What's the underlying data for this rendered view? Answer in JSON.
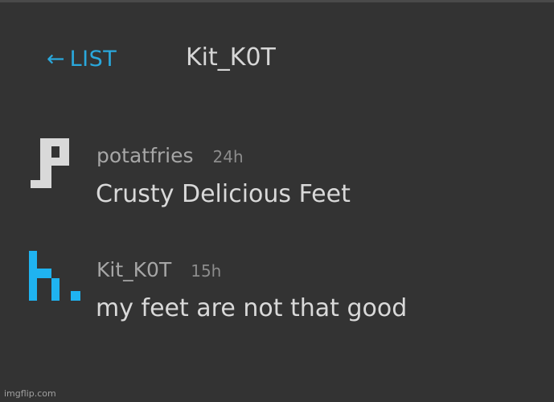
{
  "header": {
    "back_arrow": "←",
    "back_label": "LIST",
    "conversation_title": "Kit_K0T"
  },
  "messages": [
    {
      "username": "potatfries",
      "timestamp": "24h",
      "text": "Crusty Delicious Feet",
      "avatar_icon": "letter-p-pixel-icon",
      "avatar_color": "#d9d9d9"
    },
    {
      "username": "Kit_K0T",
      "timestamp": "15h",
      "text": "my feet are not that good",
      "avatar_icon": "letter-k-pixel-icon",
      "avatar_color": "#1fb3f0"
    }
  ],
  "watermark": "imgflip.com",
  "colors": {
    "background": "#333333",
    "accent": "#2aa8dc"
  }
}
